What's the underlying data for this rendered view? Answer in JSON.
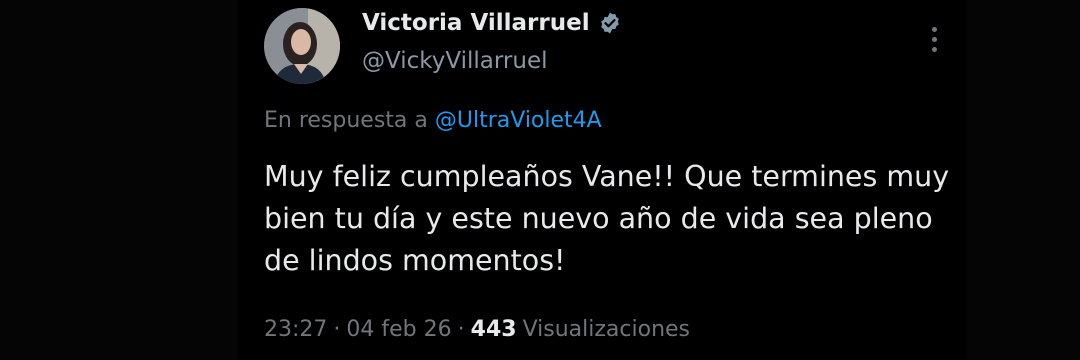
{
  "author": {
    "name": "Victoria Villarruel",
    "handle": "@VickyVillarruel",
    "verified": true,
    "verified_icon": "verified-badge-icon",
    "verified_color": "#829aab"
  },
  "reply": {
    "prefix": "En respuesta a",
    "mention": "@UltraViolet4A"
  },
  "tweet": {
    "text": "Muy feliz cumpleaños Vane!! Que termines muy bien tu día y este nuevo año de vida sea pleno de lindos momentos!"
  },
  "meta": {
    "time": "23:27",
    "separator": "·",
    "date": "04 feb 26",
    "views_count": "443",
    "views_label": "Visualizaciones"
  },
  "colors": {
    "background": "#000000",
    "text_primary": "#e7e9ea",
    "text_secondary": "#71767b",
    "link": "#1d9bf0"
  }
}
